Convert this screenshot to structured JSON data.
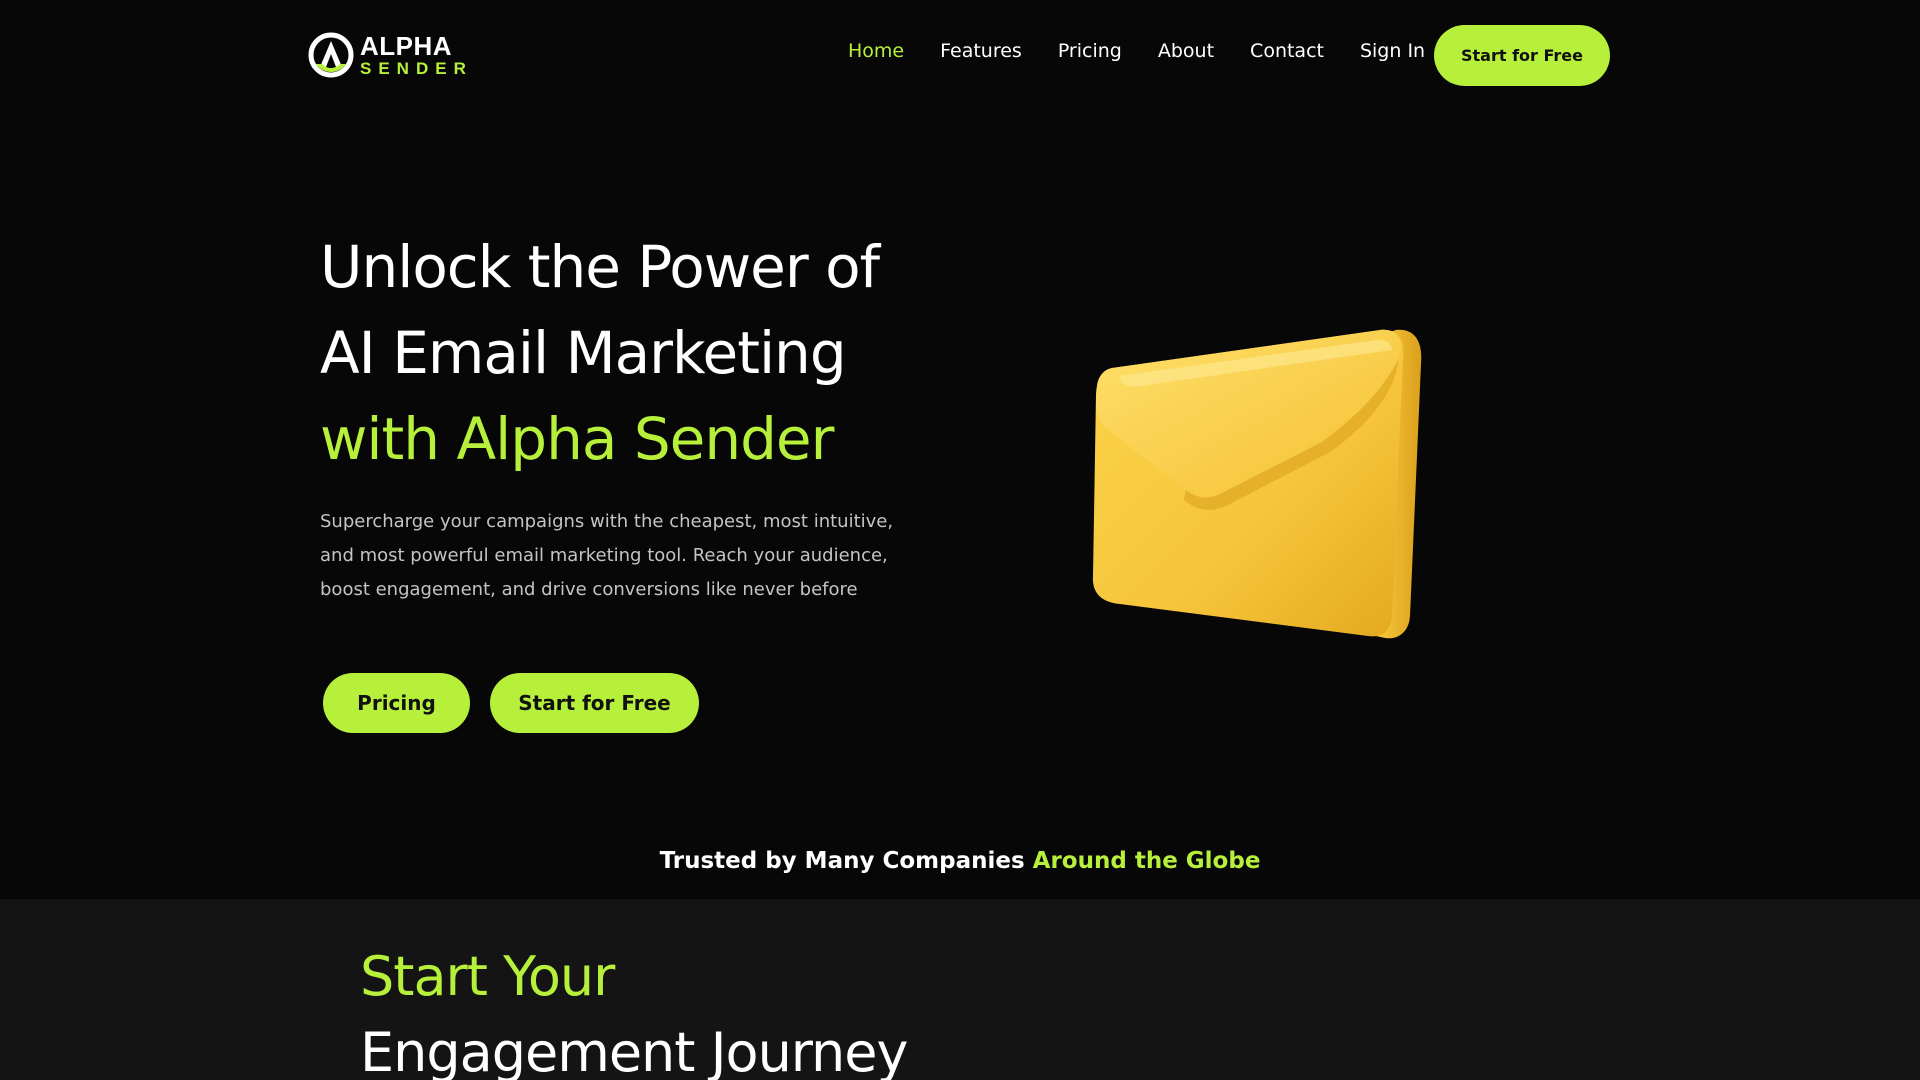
{
  "brand": {
    "logo_top": "ALPHA",
    "logo_bottom": "SENDER",
    "accent_color": "#b7f03a",
    "background_color": "#070707"
  },
  "nav": {
    "items": [
      {
        "label": "Home",
        "active": true
      },
      {
        "label": "Features",
        "active": false
      },
      {
        "label": "Pricing",
        "active": false
      },
      {
        "label": "About",
        "active": false
      },
      {
        "label": "Contact",
        "active": false
      },
      {
        "label": "Sign In",
        "active": false
      }
    ],
    "cta_label": "Start for Free"
  },
  "hero": {
    "title_line1": "Unlock the Power of",
    "title_line2": "AI Email Marketing",
    "title_line3": "with Alpha Sender",
    "subtitle": "Supercharge your campaigns with the cheapest, most intuitive, and most powerful email marketing tool. Reach your audience, boost engagement, and drive conversions like never before",
    "pricing_button": "Pricing",
    "start_button": "Start for Free",
    "illustration": "envelope-icon"
  },
  "trusted": {
    "text_main": "Trusted by Many Companies",
    "text_accent": "Around the Globe"
  },
  "journey": {
    "title_accent": "Start Your",
    "title_rest": "Engagement Journey"
  }
}
